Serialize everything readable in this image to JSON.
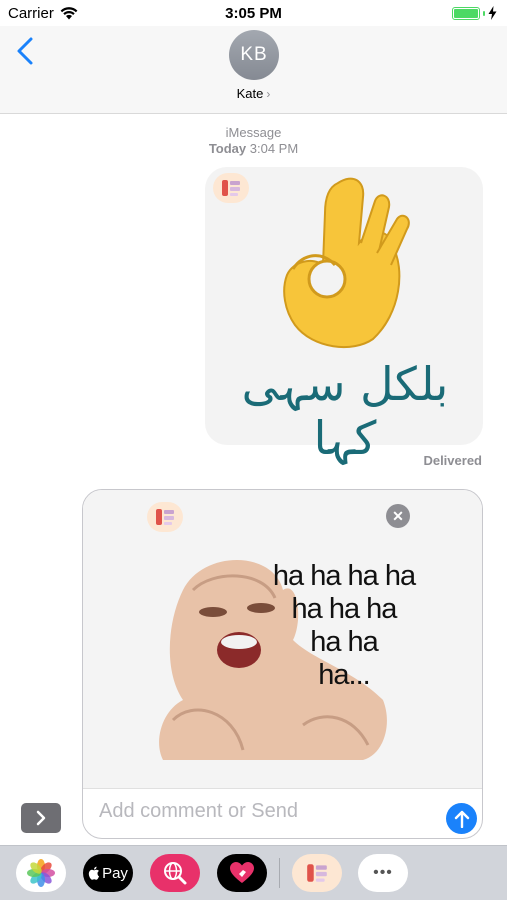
{
  "status_bar": {
    "carrier": "Carrier",
    "time": "3:05 PM"
  },
  "header": {
    "avatar_initials": "KB",
    "contact_name": "Kate",
    "chevron": "›"
  },
  "conversation": {
    "service": "iMessage",
    "day": "Today",
    "time": "3:04 PM",
    "sticker_text": "بلکل سہی کہا",
    "status": "Delivered"
  },
  "compose": {
    "sticker_lines": [
      "ha ha ha ha",
      "ha ha ha",
      "ha ha",
      "ha..."
    ],
    "placeholder": "Add comment or Send",
    "close_glyph": "✕"
  },
  "drawer": {
    "apple_pay_label": "Pay",
    "more_glyph": "•••"
  },
  "colors": {
    "accent": "#1a82fb",
    "battery": "#4cd964",
    "urdu_text": "#1a6b77"
  }
}
